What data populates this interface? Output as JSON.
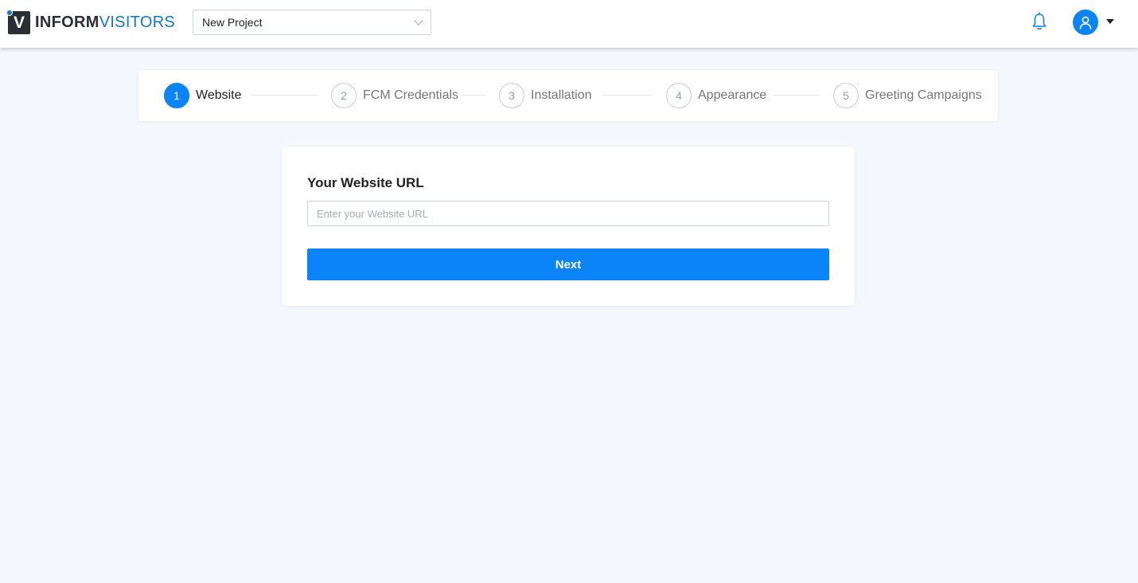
{
  "brand": {
    "logo_letter": "V",
    "name_part1": "INFORM",
    "name_part2": "VISITORS",
    "accent": "#1378c0"
  },
  "header": {
    "project_select": {
      "value": "New Project"
    },
    "icons": {
      "notifications": "bell-icon",
      "user": "user-icon",
      "menu": "caret-down-icon"
    }
  },
  "stepper": {
    "steps": [
      {
        "number": "1",
        "label": "Website",
        "active": true
      },
      {
        "number": "2",
        "label": "FCM Credentials",
        "active": false
      },
      {
        "number": "3",
        "label": "Installation",
        "active": false
      },
      {
        "number": "4",
        "label": "Appearance",
        "active": false
      },
      {
        "number": "5",
        "label": "Greeting Campaigns",
        "active": false
      }
    ]
  },
  "form": {
    "title": "Your Website URL",
    "url_input": {
      "value": "",
      "placeholder": "Enter your Website URL"
    },
    "next_label": "Next"
  },
  "colors": {
    "primary": "#0a84f7",
    "background": "#f4f7fd"
  }
}
